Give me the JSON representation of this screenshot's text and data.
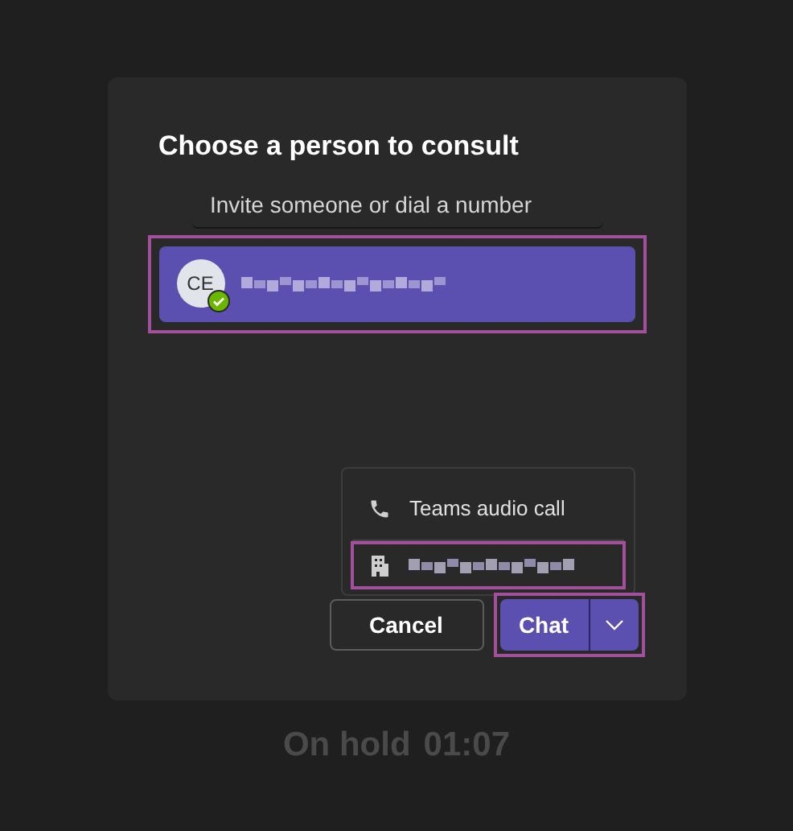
{
  "dialog": {
    "title": "Choose a person to consult",
    "search": {
      "placeholder": "Invite someone or dial a number"
    },
    "results": [
      {
        "initials": "CE",
        "available": true,
        "selected": true,
        "highlighted": true
      }
    ],
    "call_menu": [
      {
        "kind": "audio",
        "label": "Teams audio call",
        "highlighted": false
      },
      {
        "kind": "phone",
        "highlighted": true
      }
    ],
    "buttons": {
      "cancel": "Cancel",
      "chat": {
        "label": "Chat",
        "highlighted": true
      }
    }
  },
  "status": {
    "label": "On hold",
    "time": "01:07"
  }
}
